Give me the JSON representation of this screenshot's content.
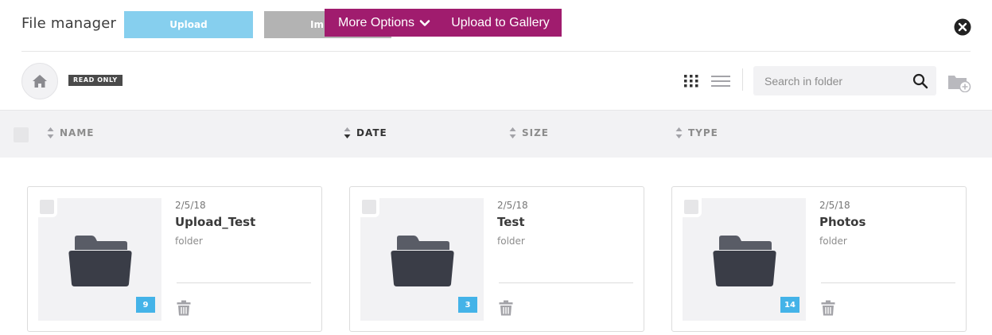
{
  "topbar": {
    "title": "File manager",
    "upload_label": "Upload",
    "import_label": "Im",
    "more_options_label": "More Options",
    "upload_gallery_label": "Upload to Gallery"
  },
  "toolbar": {
    "read_only_badge": "READ ONLY",
    "search_placeholder": "Search in folder",
    "search_value": ""
  },
  "columns": [
    {
      "label": "NAME"
    },
    {
      "label": "DATE"
    },
    {
      "label": "SIZE"
    },
    {
      "label": "TYPE"
    }
  ],
  "items": [
    {
      "date": "2/5/18",
      "name": "Upload_Test",
      "type": "folder",
      "count": "9"
    },
    {
      "date": "2/5/18",
      "name": "Test",
      "type": "folder",
      "count": "3"
    },
    {
      "date": "2/5/18",
      "name": "Photos",
      "type": "folder",
      "count": "14"
    }
  ],
  "colors": {
    "accent": "#a01c6e",
    "upload_button": "#86cfee",
    "count_badge": "#44b3e8",
    "folder": "#3a3d47"
  },
  "icons": [
    "close-icon",
    "home-icon",
    "grid-view-icon",
    "list-view-icon",
    "search-icon",
    "new-folder-icon",
    "folder-icon",
    "trash-icon",
    "chevron-down-icon",
    "sort-icon"
  ]
}
